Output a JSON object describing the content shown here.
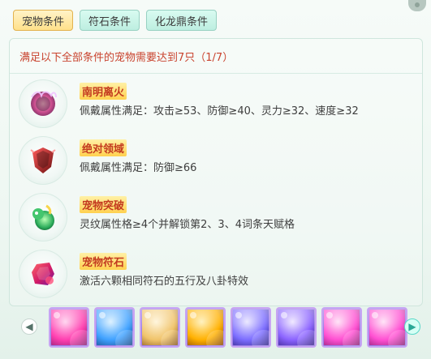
{
  "tabs": [
    {
      "label": "宠物条件",
      "active": true
    },
    {
      "label": "符石条件",
      "active": false
    },
    {
      "label": "化龙鼎条件",
      "active": false
    }
  ],
  "panel": {
    "title": "满足以下全部条件的宠物需要达到7只（1/7）"
  },
  "conditions": [
    {
      "name": "南明离火",
      "desc": "佩戴属性满足：攻击≥53、防御≥40、灵力≥32、速度≥32",
      "icon": "fire-emblem-icon"
    },
    {
      "name": "绝对领域",
      "desc": "佩戴属性满足：防御≥66",
      "icon": "shield-crest-icon"
    },
    {
      "name": "宠物突破",
      "desc": "灵纹属性格≥4个并解锁第2、3、4词条天赋格",
      "icon": "green-dragon-icon"
    },
    {
      "name": "宠物符石",
      "desc": "激活六颗相同符石的五行及八卦特效",
      "icon": "rune-stone-icon"
    }
  ],
  "pet_carousel": {
    "prev_icon": "arrow-left-icon",
    "next_icon": "arrow-right-icon",
    "pets": [
      {
        "avatar": "pet-avatar-1",
        "color": "#ff3fb0"
      },
      {
        "avatar": "pet-avatar-2",
        "color": "#3fa1ff"
      },
      {
        "avatar": "pet-avatar-3",
        "color": "#f0c36a"
      },
      {
        "avatar": "pet-avatar-4",
        "color": "#ffb000"
      },
      {
        "avatar": "pet-avatar-5",
        "color": "#7c6dff"
      },
      {
        "avatar": "pet-avatar-6",
        "color": "#8b63ff"
      },
      {
        "avatar": "pet-avatar-7",
        "color": "#ff4fd2"
      },
      {
        "avatar": "pet-avatar-8",
        "color": "#ff4fd2"
      }
    ]
  }
}
